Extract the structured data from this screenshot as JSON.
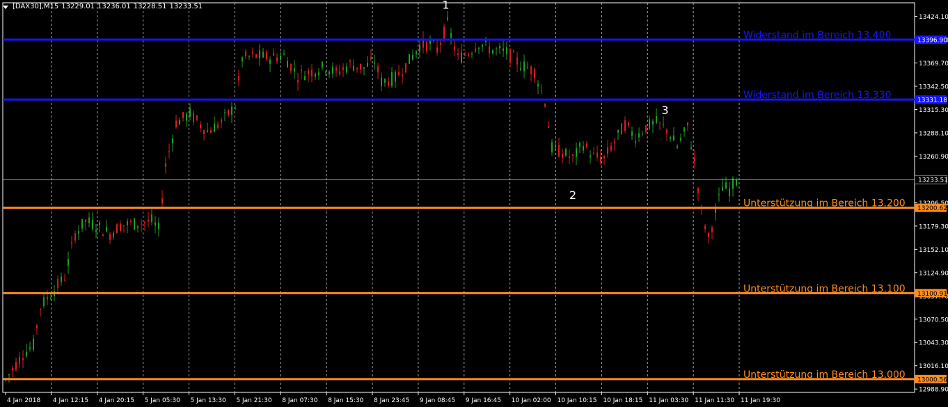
{
  "header": {
    "symbol": "[DAX30],M15",
    "open": "13229.01",
    "high": "13236.01",
    "low": "13228.51",
    "close": "13233.51"
  },
  "colors": {
    "background": "#000000",
    "up_candle": "#1f9e24",
    "down_candle": "#d81e1e",
    "grid": "#c8c8c8",
    "frame": "#ffffff",
    "resistance": "#1515ff",
    "support": "#ff8c1a",
    "current_price_line": "#9aa3b5",
    "axis_text": "#ffffff"
  },
  "chart_data": {
    "type": "candlestick",
    "symbol": "[DAX30]",
    "timeframe": "M15",
    "ylim": [
      12985,
      13440
    ],
    "y_ticks": [
      "13424.10",
      "13396.90",
      "13369.70",
      "13342.50",
      "13315.30",
      "13288.10",
      "13260.90",
      "13206.50",
      "13179.30",
      "13152.10",
      "13124.90",
      "13097.70",
      "13070.50",
      "13043.30",
      "13016.10",
      "12988.90"
    ],
    "x_ticks": [
      "4 Jan 2018",
      "4 Jan 12:15",
      "4 Jan 20:15",
      "5 Jan 05:30",
      "5 Jan 13:30",
      "5 Jan 21:30",
      "8 Jan 07:30",
      "8 Jan 15:30",
      "8 Jan 23:45",
      "9 Jan 08:45",
      "9 Jan 16:45",
      "10 Jan 02:00",
      "10 Jan 10:15",
      "10 Jan 18:15",
      "11 Jan 03:30",
      "11 Jan 11:30",
      "11 Jan 19:30"
    ],
    "grid": "vertical dashed",
    "current_price": 13233.51,
    "current_price_label": "13233.51",
    "levels": [
      {
        "price": 13396.9,
        "axis_label": "13396.90",
        "text": "Widerstand im Bereich 13.400",
        "kind": "resistance"
      },
      {
        "price": 13327.0,
        "axis_label": "13331.18",
        "text": "Widerstand im Bereich 13.330",
        "kind": "resistance"
      },
      {
        "price": 13200.62,
        "axis_label": "13200.62",
        "text": "Unterstützung im Bereich 13.200",
        "kind": "support"
      },
      {
        "price": 13100.91,
        "axis_label": "13100.91",
        "text": "Unterstützung im Bereich 13.100",
        "kind": "support"
      },
      {
        "price": 13000.56,
        "axis_label": "13000.56",
        "text": "Unterstützung im Bereich 13.000",
        "kind": "support"
      }
    ],
    "annotations": [
      {
        "text": "1",
        "x_index": 126.5,
        "price": 13433
      },
      {
        "text": "2",
        "x_index": 163,
        "price": 13211
      },
      {
        "text": "3",
        "x_index": 189.5,
        "price": 13310
      }
    ],
    "price_path": [
      [
        0,
        13000
      ],
      [
        5,
        13030
      ],
      [
        8,
        13040
      ],
      [
        10,
        13085
      ],
      [
        13,
        13100
      ],
      [
        17,
        13120
      ],
      [
        20,
        13170
      ],
      [
        23,
        13185
      ],
      [
        26,
        13180
      ],
      [
        30,
        13170
      ],
      [
        33,
        13180
      ],
      [
        37,
        13182
      ],
      [
        42,
        13185
      ],
      [
        44,
        13175
      ],
      [
        46,
        13250
      ],
      [
        49,
        13300
      ],
      [
        53,
        13310
      ],
      [
        58,
        13290
      ],
      [
        62,
        13300
      ],
      [
        66,
        13320
      ],
      [
        68,
        13375
      ],
      [
        72,
        13378
      ],
      [
        76,
        13376
      ],
      [
        80,
        13378
      ],
      [
        84,
        13355
      ],
      [
        88,
        13360
      ],
      [
        92,
        13365
      ],
      [
        95,
        13358
      ],
      [
        99,
        13368
      ],
      [
        103,
        13364
      ],
      [
        106,
        13372
      ],
      [
        108,
        13348
      ],
      [
        112,
        13352
      ],
      [
        116,
        13372
      ],
      [
        119,
        13390
      ],
      [
        122,
        13392
      ],
      [
        124,
        13385
      ],
      [
        127,
        13415
      ],
      [
        130,
        13375
      ],
      [
        133,
        13382
      ],
      [
        136,
        13393
      ],
      [
        140,
        13385
      ],
      [
        144,
        13382
      ],
      [
        148,
        13368
      ],
      [
        152,
        13360
      ],
      [
        155,
        13325
      ],
      [
        157,
        13270
      ],
      [
        160,
        13265
      ],
      [
        163,
        13258
      ],
      [
        166,
        13275
      ],
      [
        169,
        13260
      ],
      [
        172,
        13258
      ],
      [
        175,
        13278
      ],
      [
        178,
        13298
      ],
      [
        181,
        13283
      ],
      [
        184,
        13295
      ],
      [
        187,
        13300
      ],
      [
        190,
        13292
      ],
      [
        193,
        13272
      ],
      [
        196,
        13295
      ],
      [
        198,
        13255
      ],
      [
        200,
        13195
      ],
      [
        202,
        13165
      ],
      [
        204,
        13195
      ],
      [
        206,
        13225
      ],
      [
        208,
        13222
      ],
      [
        210,
        13233.51
      ]
    ]
  }
}
